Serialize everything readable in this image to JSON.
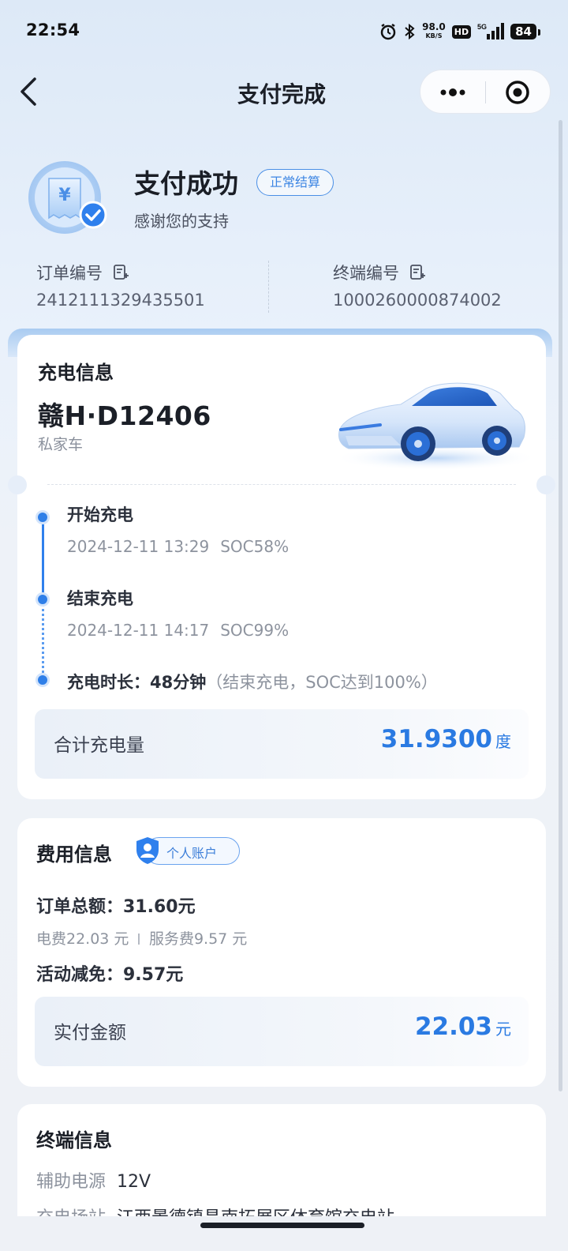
{
  "status_bar": {
    "time": "22:54",
    "net_speed": "98.0",
    "net_speed_unit": "KB/S",
    "hd": "HD",
    "network": "5G",
    "battery": "84"
  },
  "nav": {
    "title": "支付完成"
  },
  "header": {
    "title": "支付成功",
    "status_badge": "正常结算",
    "subtitle": "感谢您的支持",
    "order_label": "订单编号",
    "order_no": "2412111329435501",
    "terminal_label": "终端编号",
    "terminal_no": "1000260000874002"
  },
  "charge_info": {
    "title": "充电信息",
    "plate": "赣H·D12406",
    "vehicle_type": "私家车",
    "start_title": "开始充电",
    "start_time": "2024-12-11 13:29",
    "start_soc": "SOC58%",
    "end_title": "结束充电",
    "end_time": "2024-12-11 14:17",
    "end_soc": "SOC99%",
    "duration_label": "充电时长：",
    "duration_value": "48分钟",
    "duration_note": "（结束充电，SOC达到100%）",
    "total_label": "合计充电量",
    "total_value": "31.9300",
    "total_unit": "度"
  },
  "fee_info": {
    "title": "费用信息",
    "account_badge": "个人账户",
    "order_total": "订单总额：31.60元",
    "electric_fee": "电费22.03 元",
    "service_fee": "服务费9.57 元",
    "discount": "活动减免：9.57元",
    "paid_label": "实付金额",
    "paid_value": "22.03",
    "paid_unit": "元"
  },
  "terminal_info": {
    "title": "终端信息",
    "aux_power_label": "辅助电源",
    "aux_power_value": "12V",
    "station_label": "充电场站",
    "station_value": "江西景德镇昌南拓展区体育馆充电站"
  },
  "colors": {
    "accent": "#2a7ae2",
    "background": "#e9f1fb"
  }
}
